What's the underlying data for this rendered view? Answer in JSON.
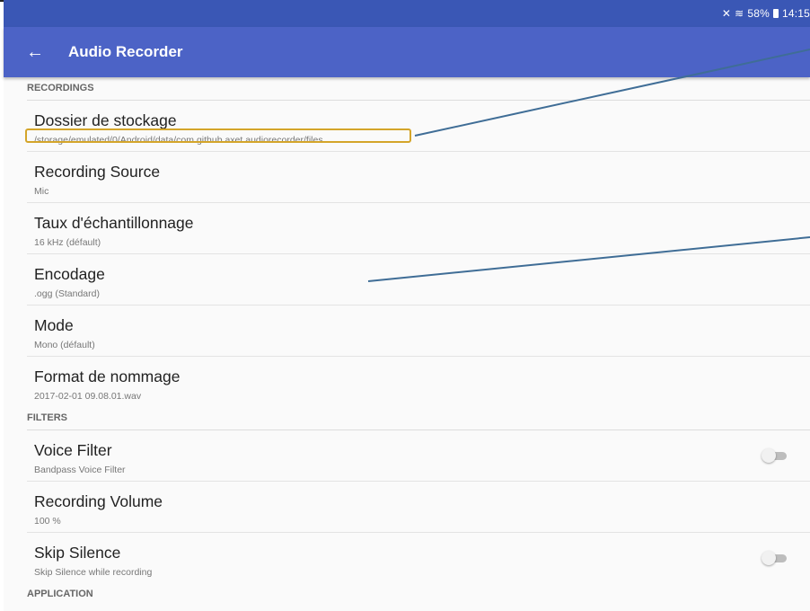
{
  "status": {
    "text": "58%",
    "time": "14:15",
    "icons": [
      "mute-icon",
      "wifi-icon",
      "battery-icon"
    ]
  },
  "appbar": {
    "title": "Audio Recorder",
    "back_icon": "arrow-left-icon"
  },
  "sections": [
    {
      "header": "RECORDINGS"
    },
    {
      "header": "FILTERS"
    },
    {
      "header": "APPLICATION"
    }
  ],
  "recordings": [
    {
      "label": "Dossier de stockage",
      "value": "/storage/emulated/0/Android/data/com.github.axet.audiorecorder/files"
    },
    {
      "label": "Recording Source",
      "value": "Mic"
    },
    {
      "label": "Taux d'échantillonnage",
      "value": "16 kHz (défault)"
    },
    {
      "label": "Encodage",
      "value": ".ogg (Standard)"
    },
    {
      "label": "Mode",
      "value": "Mono (défault)"
    },
    {
      "label": "Format de nommage",
      "value": "2017-02-01 09.08.01.wav"
    }
  ],
  "filters": [
    {
      "label": "Voice Filter",
      "value": "Bandpass Voice Filter",
      "toggle": false
    },
    {
      "label": "Recording Volume",
      "value": "100 %"
    },
    {
      "label": "Skip Silence",
      "value": "Skip Silence while recording",
      "toggle": false
    }
  ],
  "colors": {
    "appbar": "#4c63c6",
    "statusbar": "#3a57b5",
    "highlight": "#d4a52a",
    "annotation_line": "#3f6d96"
  }
}
